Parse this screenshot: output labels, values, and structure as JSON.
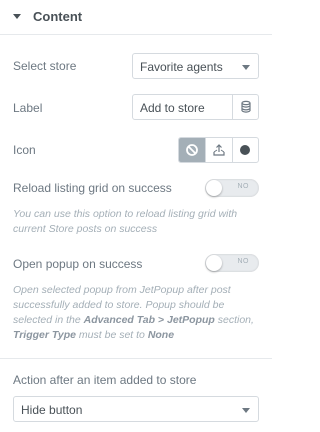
{
  "section": {
    "title": "Content"
  },
  "store": {
    "label": "Select store",
    "value": "Favorite agents"
  },
  "label_field": {
    "label": "Label",
    "value": "Add to store"
  },
  "icon": {
    "label": "Icon"
  },
  "reload": {
    "label": "Reload listing grid on success",
    "toggle_text": "NO",
    "description": "You can use this option to reload listing grid with current Store posts on success"
  },
  "popup": {
    "label": "Open popup on success",
    "toggle_text": "NO",
    "desc_part1": "Open selected popup from JetPopup after post successfully added to store. Popup should be selected in the ",
    "desc_bold1": "Advanced Tab > JetPopup",
    "desc_part2": " section, ",
    "desc_bold2": "Trigger Type",
    "desc_part3": " must be set to ",
    "desc_bold3": "None"
  },
  "action": {
    "label": "Action after an item added to store",
    "value": "Hide button"
  },
  "colors": {
    "accent": "#a4afb7",
    "text": "#6d7882",
    "border": "#d5dadf"
  }
}
